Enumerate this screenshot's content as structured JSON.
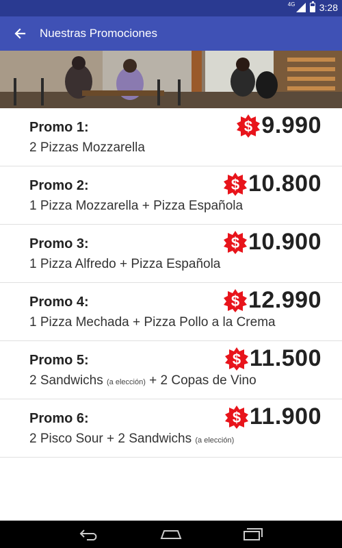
{
  "status_bar": {
    "network": "4G",
    "time": "3:28"
  },
  "app_bar": {
    "title": "Nuestras Promociones"
  },
  "currency_symbol": "$",
  "promos": [
    {
      "name": "Promo 1:",
      "desc": "2 Pizzas Mozzarella",
      "desc_note": "",
      "desc_after": "",
      "price": " 9.990"
    },
    {
      "name": "Promo 2:",
      "desc": "1 Pizza Mozzarella + Pizza Española",
      "desc_note": "",
      "desc_after": "",
      "price": "10.800"
    },
    {
      "name": "Promo 3:",
      "desc": "1 Pizza Alfredo + Pizza Española",
      "desc_note": "",
      "desc_after": "",
      "price": "10.900"
    },
    {
      "name": "Promo 4:",
      "desc": "1 Pizza Mechada + Pizza Pollo a la Crema",
      "desc_note": "",
      "desc_after": "",
      "price": "12.990"
    },
    {
      "name": "Promo 5:",
      "desc": "2 Sandwichs ",
      "desc_note": "(a elección)",
      "desc_after": " + 2 Copas de Vino",
      "price": "11.500"
    },
    {
      "name": "Promo 6:",
      "desc": "2 Pisco Sour + 2 Sandwichs ",
      "desc_note": "(a elección)",
      "desc_after": "",
      "price": "11.900"
    }
  ],
  "colors": {
    "status_bar": "#2a3a91",
    "app_bar": "#3f51b5",
    "badge": "#e8141b"
  }
}
